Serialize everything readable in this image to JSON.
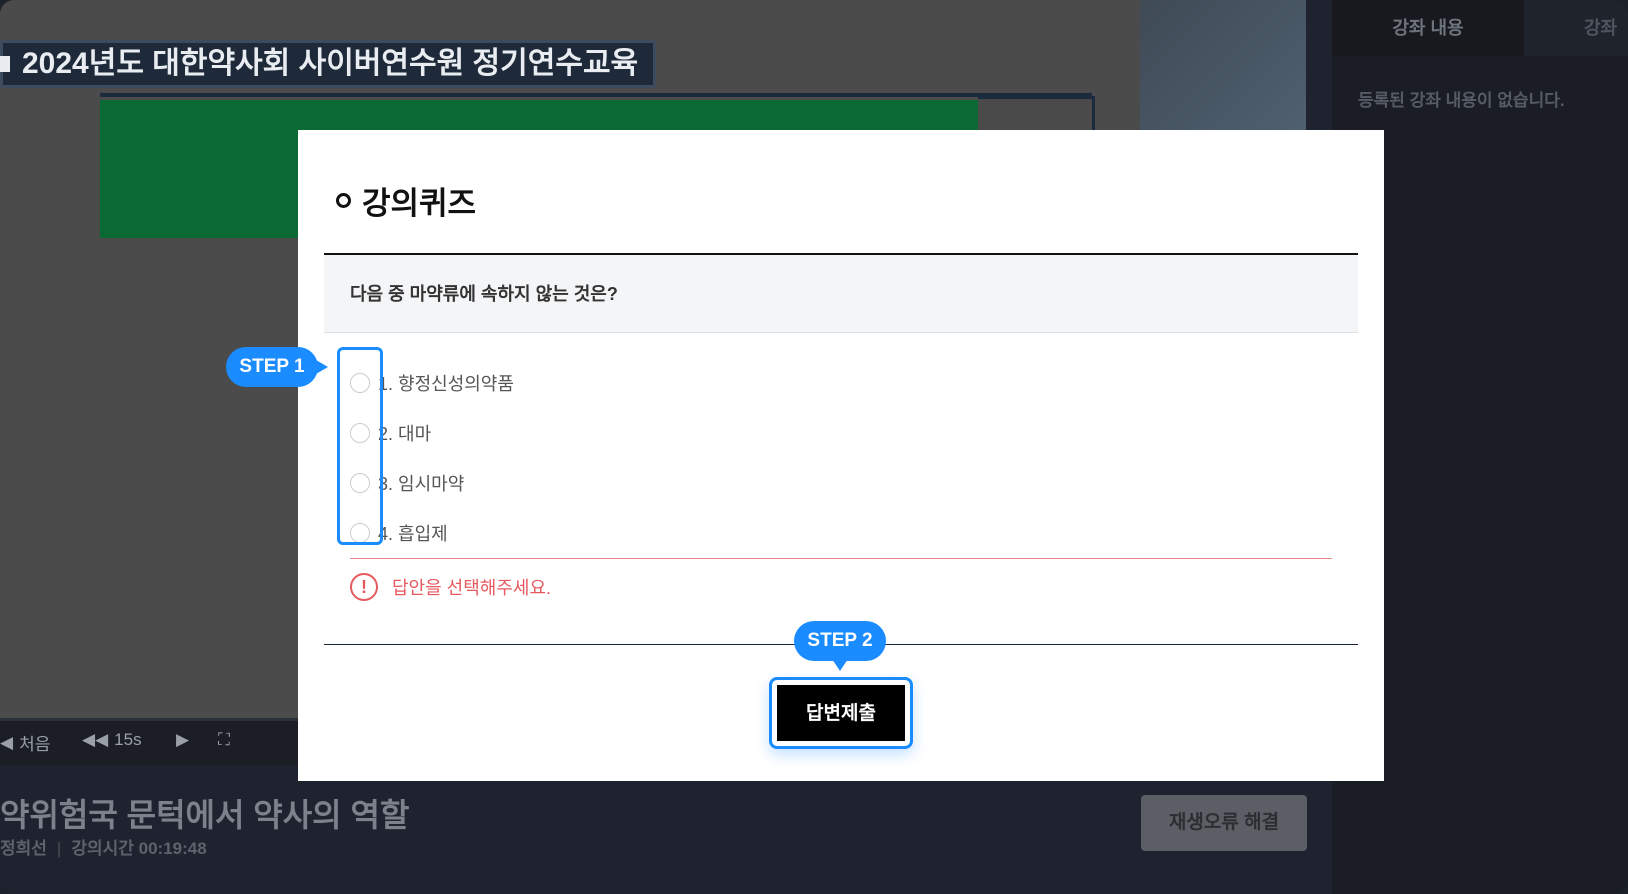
{
  "video": {
    "slide_title": "2024년도 대한약사회 사이버연수원 정기연수교육"
  },
  "controls": {
    "first_label": "처음",
    "rewind_label": "15s"
  },
  "lecture": {
    "title": "약위험국 문턱에서 약사의 역할",
    "instructor": "정희선",
    "duration_label": "강의시간 00:19:48",
    "error_button": "재생오류 해결"
  },
  "sidebar": {
    "tabs": [
      {
        "label": "강좌 내용"
      },
      {
        "label": "강좌 "
      }
    ],
    "empty_text": "등록된 강좌 내용이 없습니다."
  },
  "quiz": {
    "title": "강의퀴즈",
    "question": "다음 중 마약류에 속하지 않는 것은?",
    "options": [
      {
        "label": "1. 향정신성의약품"
      },
      {
        "label": "2. 대마"
      },
      {
        "label": "3. 임시마약"
      },
      {
        "label": "4. 흡입제"
      }
    ],
    "error_message": "답안을 선택해주세요.",
    "submit_label": "답변제출"
  },
  "steps": {
    "step1": "STEP 1",
    "step2": "STEP 2"
  },
  "colors": {
    "accent": "#1a8cff",
    "error": "#e65a5f"
  }
}
